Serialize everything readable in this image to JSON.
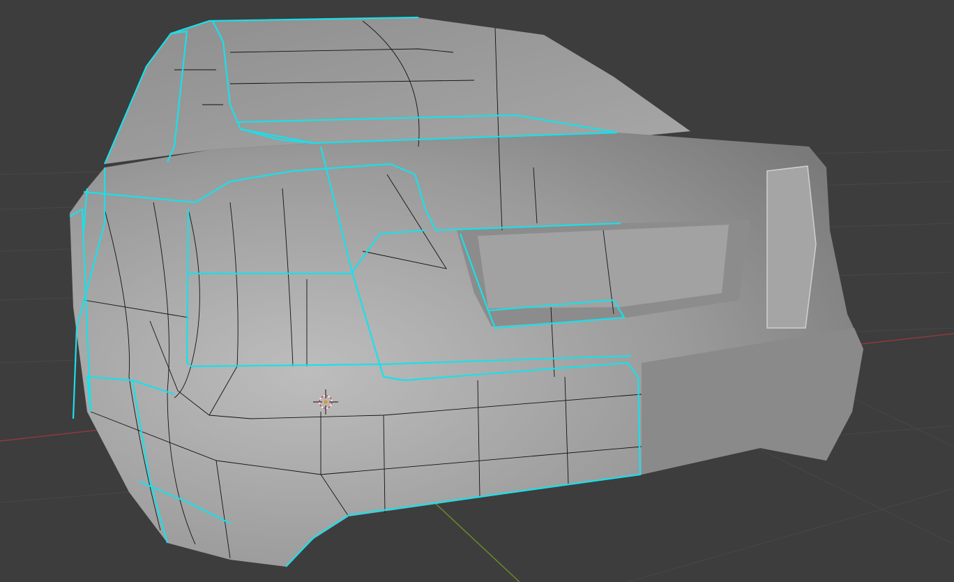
{
  "viewport": {
    "background": "#3d3d3d",
    "grid_color": "#4a4a4a",
    "x_axis_color": "#9a3a3a",
    "y_axis_color": "#6a8a2a",
    "seam_color": "#19e0ea",
    "wire_color": "#111111",
    "mesh_light": "#b4b4b4",
    "mesh_dark": "#6e6e6e"
  }
}
